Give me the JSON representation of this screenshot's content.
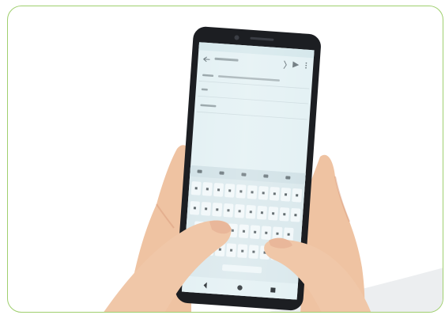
{
  "photo": {
    "frame_color": "#9fcf6e",
    "background_color": "#ffffff",
    "phone_body_color": "#1c1e22",
    "screen_color": "#e4f1f4",
    "skin_color": "#f0c7a8",
    "skin_shadow_color": "#d99b7c"
  },
  "screen_content": {
    "top_bar_icons": [
      "back-arrow-icon",
      "attachment-icon",
      "send-icon",
      "more-icon"
    ],
    "keyboard_toolbar_icons": [
      "emoji-icon",
      "gif-icon",
      "clipboard-icon",
      "settings-icon",
      "mic-icon"
    ],
    "keyboard_rows": [
      10,
      10,
      9,
      7
    ]
  }
}
